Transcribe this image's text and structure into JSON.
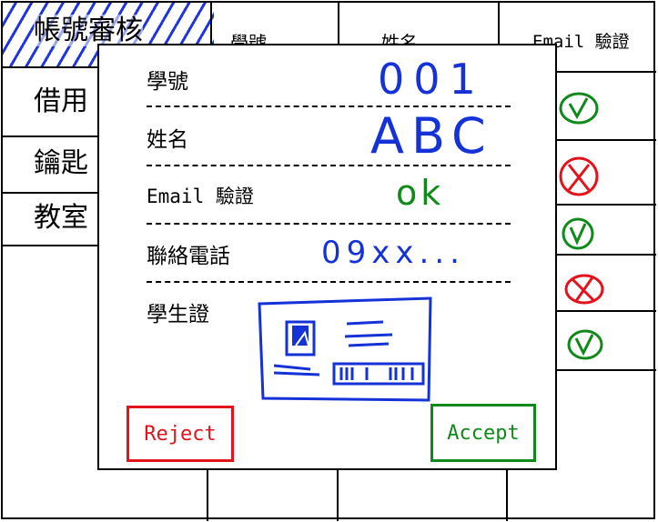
{
  "sidebar": {
    "items": [
      {
        "label": "帳號審核",
        "active": true
      },
      {
        "label": "借用"
      },
      {
        "label": "鑰匙"
      },
      {
        "label": "教室"
      }
    ]
  },
  "table": {
    "columns": [
      "學號",
      "姓名",
      "Email 驗證"
    ],
    "verify_marks": [
      "check",
      "cross",
      "check",
      "cross",
      "check"
    ]
  },
  "modal": {
    "fields": [
      {
        "label": "學號",
        "value": "001"
      },
      {
        "label": "姓名",
        "value": "ABC"
      },
      {
        "label": "Email 驗證",
        "value": "ok"
      },
      {
        "label": "聯絡電話",
        "value": "09xx..."
      },
      {
        "label": "學生證",
        "value": ""
      }
    ],
    "reject_label": "Reject",
    "accept_label": "Accept"
  },
  "colors": {
    "highlight": "#1f35e0",
    "handwriting": "#1432d8",
    "ok": "#0f8a1a",
    "reject": "#e3121b"
  }
}
